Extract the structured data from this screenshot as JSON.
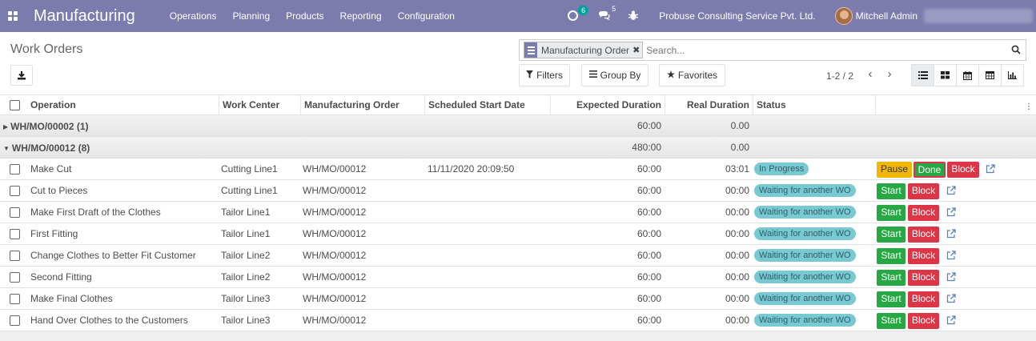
{
  "navbar": {
    "brand": "Manufacturing",
    "menu": [
      "Operations",
      "Planning",
      "Products",
      "Reporting",
      "Configuration"
    ],
    "activity_count": "6",
    "messages_count": "5",
    "company": "Probuse Consulting Service Pvt. Ltd.",
    "user": "Mitchell Admin"
  },
  "control_panel": {
    "title": "Work Orders",
    "facet": "Manufacturing Order",
    "facet_remove": "✖",
    "search_placeholder": "Search...",
    "filters_label": "Filters",
    "groupby_label": "Group By",
    "favorites_label": "Favorites",
    "pager": "1-2 / 2"
  },
  "table": {
    "headers": {
      "operation": "Operation",
      "work_center": "Work Center",
      "mo": "Manufacturing Order",
      "start": "Scheduled Start Date",
      "expected": "Expected Duration",
      "real": "Real Duration",
      "status": "Status"
    },
    "groups": [
      {
        "name": "WH/MO/00002 (1)",
        "expected": "60:00",
        "real": "0.00",
        "expanded": false
      },
      {
        "name": "WH/MO/00012 (8)",
        "expected": "480:00",
        "real": "0.00",
        "expanded": true
      }
    ],
    "rows": [
      {
        "operation": "Make Cut",
        "work_center": "Cutting Line1",
        "mo": "WH/MO/00012",
        "start": "11/11/2020 20:09:50",
        "expected": "60:00",
        "real": "03:01",
        "status": "In Progress"
      },
      {
        "operation": "Cut to Pieces",
        "work_center": "Cutting Line1",
        "mo": "WH/MO/00012",
        "start": "",
        "expected": "60:00",
        "real": "00:00",
        "status": "Waiting for another WO"
      },
      {
        "operation": "Make First Draft of the Clothes",
        "work_center": "Tailor Line1",
        "mo": "WH/MO/00012",
        "start": "",
        "expected": "60:00",
        "real": "00:00",
        "status": "Waiting for another WO"
      },
      {
        "operation": "First Fitting",
        "work_center": "Tailor Line1",
        "mo": "WH/MO/00012",
        "start": "",
        "expected": "60:00",
        "real": "00:00",
        "status": "Waiting for another WO"
      },
      {
        "operation": "Change Clothes to Better Fit Customer",
        "work_center": "Tailor Line2",
        "mo": "WH/MO/00012",
        "start": "",
        "expected": "60:00",
        "real": "00:00",
        "status": "Waiting for another WO"
      },
      {
        "operation": "Second Fitting",
        "work_center": "Tailor Line2",
        "mo": "WH/MO/00012",
        "start": "",
        "expected": "60:00",
        "real": "00:00",
        "status": "Waiting for another WO"
      },
      {
        "operation": "Make Final Clothes",
        "work_center": "Tailor Line3",
        "mo": "WH/MO/00012",
        "start": "",
        "expected": "60:00",
        "real": "00:00",
        "status": "Waiting for another WO"
      },
      {
        "operation": "Hand Over Clothes to the Customers",
        "work_center": "Tailor Line3",
        "mo": "WH/MO/00012",
        "start": "",
        "expected": "60:00",
        "real": "00:00",
        "status": "Waiting for another WO"
      }
    ],
    "buttons": {
      "pause": "Pause",
      "done": "Done",
      "block": "Block",
      "start": "Start"
    }
  },
  "colors": {
    "navbar": "#7c7bad",
    "start": "#28a745",
    "block": "#dc3545",
    "pause": "#f2b705",
    "status_pill": "#79c9d2"
  }
}
